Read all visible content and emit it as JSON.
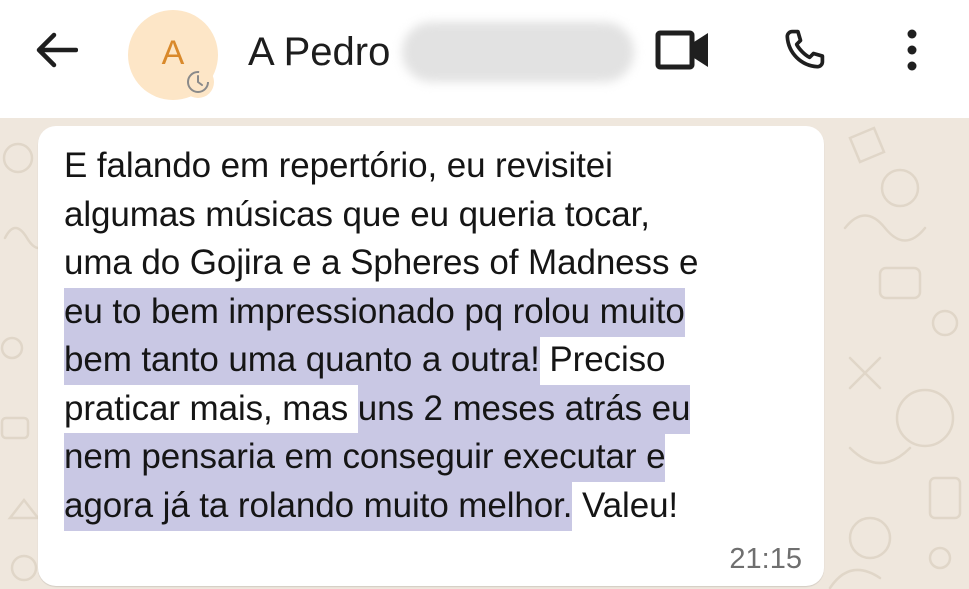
{
  "header": {
    "back_icon": "arrow-left-icon",
    "avatar_letter": "A",
    "avatar_badge_icon": "clock-icon",
    "contact_name": "A Pedro",
    "actions": [
      {
        "name": "video-call",
        "icon": "video-camera-icon"
      },
      {
        "name": "voice-call",
        "icon": "phone-icon"
      },
      {
        "name": "more-options",
        "icon": "more-vertical-icon"
      }
    ]
  },
  "message": {
    "lines": [
      {
        "segments": [
          {
            "text": "E falando em repertório, eu revisitei",
            "highlight": false
          }
        ]
      },
      {
        "segments": [
          {
            "text": "algumas músicas que eu queria tocar,",
            "highlight": false
          }
        ]
      },
      {
        "segments": [
          {
            "text": "uma do Gojira e a Spheres of Madness e",
            "highlight": false
          }
        ]
      },
      {
        "segments": [
          {
            "text": "eu to bem impressionado pq rolou muito",
            "highlight": true
          }
        ]
      },
      {
        "segments": [
          {
            "text": "bem tanto uma quanto a outra!",
            "highlight": true
          },
          {
            "text": " Preciso",
            "highlight": false
          }
        ]
      },
      {
        "segments": [
          {
            "text": "praticar mais, mas ",
            "highlight": false
          },
          {
            "text": "uns 2 meses atrás eu",
            "highlight": true
          }
        ]
      },
      {
        "segments": [
          {
            "text": "nem pensaria em conseguir executar e",
            "highlight": true
          }
        ]
      },
      {
        "segments": [
          {
            "text": "agora já ta rolando muito melhor.",
            "highlight": true
          },
          {
            "text": " Valeu!",
            "highlight": false
          }
        ]
      }
    ],
    "time": "21:15"
  },
  "colors": {
    "highlight": "#c9c8e4",
    "chat_background": "#efe7dd",
    "avatar_background": "#fde6c7",
    "avatar_letter": "#d9892b"
  }
}
